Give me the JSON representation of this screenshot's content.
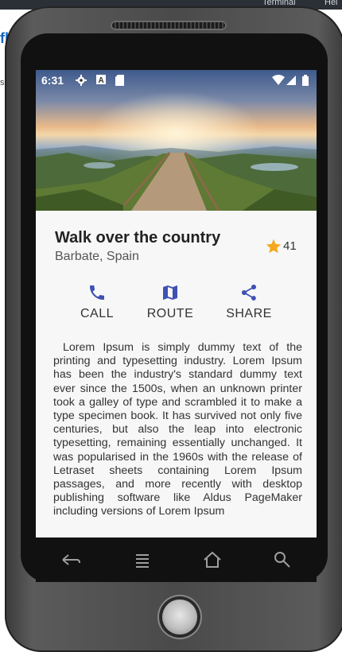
{
  "desktop": {
    "menu_items": [
      "Terminal",
      "Hel"
    ],
    "side_text": "flu",
    "side_text2": "s:"
  },
  "status_bar": {
    "time": "6:31",
    "icons": [
      "gear-icon",
      "a-icon",
      "sd-card-icon",
      "wifi-icon",
      "signal-icon",
      "battery-icon"
    ]
  },
  "header": {
    "title": "Walk over the country",
    "subtitle": "Barbate, Spain",
    "rating": "41"
  },
  "actions": [
    {
      "label": "CALL",
      "icon": "phone-icon"
    },
    {
      "label": "ROUTE",
      "icon": "map-icon"
    },
    {
      "label": "SHARE",
      "icon": "share-icon"
    }
  ],
  "description": "Lorem Ipsum is simply dummy text of the printing and typesetting industry. Lorem Ipsum has been the industry's standard dummy text ever since the 1500s, when an unknown printer took a galley of type and scrambled it to make a type specimen book. It has survived not only five centuries, but also the leap into electronic typesetting, remaining essentially unchanged. It was popularised in the 1960s with the release of Letraset sheets containing Lorem Ipsum passages, and more recently with desktop publishing software like Aldus PageMaker including versions of Lorem Ipsum",
  "nav_bar": [
    "back-icon",
    "menu-icon",
    "home-icon",
    "search-icon"
  ],
  "colors": {
    "accent": "#3f51b5",
    "star": "#f4a81d",
    "screen_bg": "#f7f7f7"
  }
}
